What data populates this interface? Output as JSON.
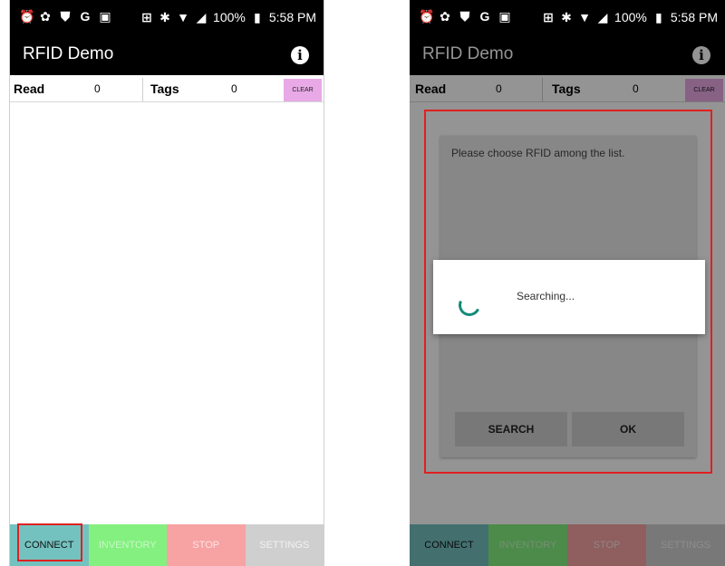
{
  "status_bar": {
    "battery": "100%",
    "time": "5:58 PM",
    "icons_left": [
      "alarm-icon",
      "gear-icon",
      "shield-icon",
      "google-icon",
      "image-icon"
    ],
    "icons_right": [
      "nfc-icon",
      "bluetooth-icon",
      "wifi-icon",
      "signal-icon",
      "battery-icon"
    ]
  },
  "app": {
    "title": "RFID Demo",
    "info_icon": "info-icon"
  },
  "counters": {
    "read_label": "Read",
    "read_value": "0",
    "tags_label": "Tags",
    "tags_value": "0",
    "clear_label": "CLEAR"
  },
  "bottom_bar": {
    "connect": "CONNECT",
    "inventory": "INVENTORY",
    "stop": "STOP",
    "settings": "SETTINGS"
  },
  "dialog": {
    "message": "Please choose RFID among the list.",
    "search_button": "SEARCH",
    "ok_button": "OK"
  },
  "progress": {
    "text": "Searching..."
  },
  "colors": {
    "connect": "#74c2c0",
    "inventory": "#83f07f",
    "stop": "#f7a3a3",
    "settings": "#cfcfcf",
    "clear": "#e8a9e6",
    "highlight": "#e02020",
    "spinner": "#138a7a"
  }
}
